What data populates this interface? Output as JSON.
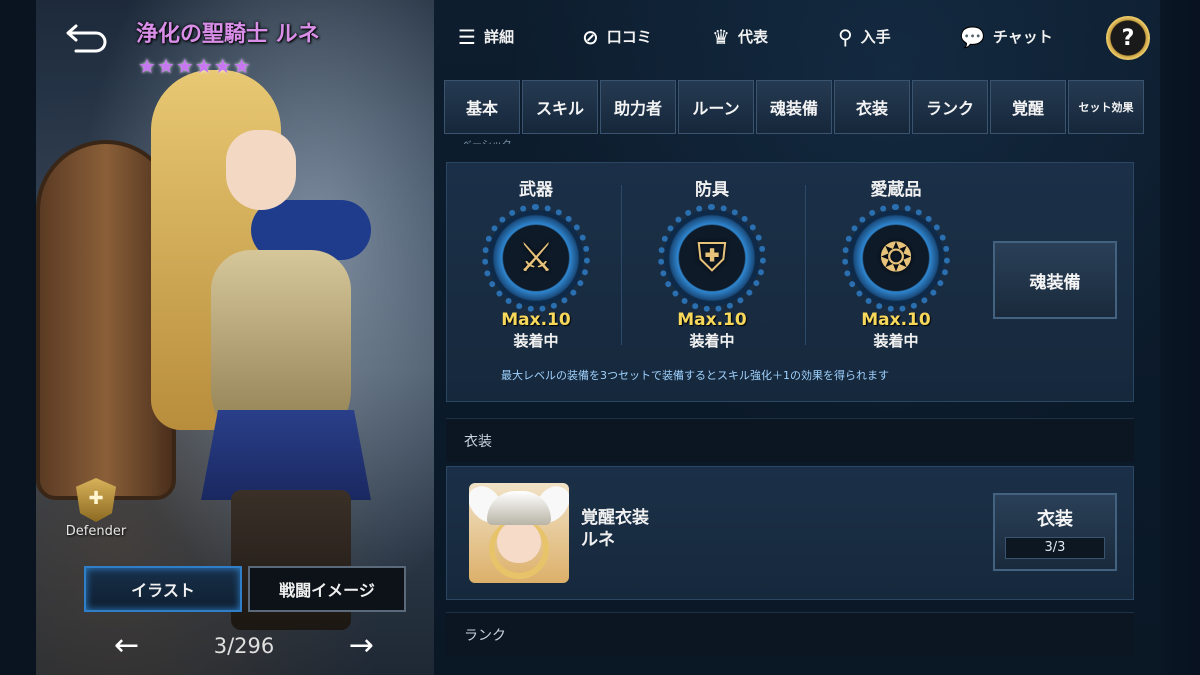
{
  "hero": {
    "name": "浄化の聖騎士 ルネ",
    "stars": [
      "★",
      "★",
      "★",
      "★",
      "★",
      "★"
    ],
    "class": "Defender"
  },
  "view_tabs": {
    "illust": "イラスト",
    "battle": "戦闘イメージ"
  },
  "pager": {
    "prev": "←",
    "count": "3/296",
    "next": "→"
  },
  "topnav": {
    "details": "詳細",
    "reviews": "口コミ",
    "representative": "代表",
    "obtain": "入手",
    "chat": "チャット",
    "help": "?"
  },
  "category_tabs": [
    "基本",
    "スキル",
    "助力者",
    "ルーン",
    "魂装備",
    "衣装",
    "ランク",
    "覚醒",
    "セット効果"
  ],
  "cut_label": "ベーシック",
  "equipment": {
    "weapon": {
      "title": "武器",
      "max": "Max.10",
      "state": "装着中"
    },
    "armor": {
      "title": "防具",
      "max": "Max.10",
      "state": "装着中"
    },
    "treasure": {
      "title": "愛蔵品",
      "max": "Max.10",
      "state": "装着中"
    },
    "soul_button": "魂装備",
    "set_note": "最大レベルの装備を3つセットで装備するとスキル強化＋1の効果を得られます"
  },
  "costume_section": {
    "header": "衣装",
    "name_line1": "覚醒衣装",
    "name_line2": "ルネ",
    "button": "衣装",
    "count": "3/3"
  },
  "rank_section": {
    "header": "ランク"
  },
  "colors": {
    "accent_blue": "#2f7fc8",
    "max_gold": "#f7d85a",
    "name_purple": "#d98ee8"
  }
}
